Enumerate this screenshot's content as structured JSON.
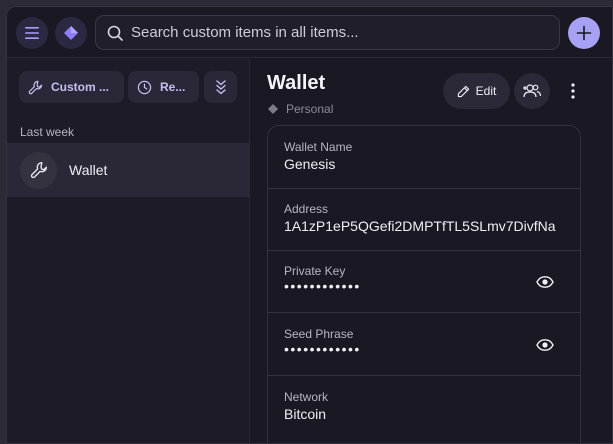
{
  "header": {
    "search_placeholder": "Search custom items in all items..."
  },
  "sidebar": {
    "filters": {
      "type_label": "Custom ...",
      "sort_label": "Re..."
    },
    "section_label": "Last week",
    "items": [
      {
        "title": "Wallet"
      }
    ]
  },
  "item": {
    "title": "Wallet",
    "vault": "Personal",
    "edit_label": "Edit",
    "fields": [
      {
        "label": "Wallet Name",
        "value": "Genesis"
      },
      {
        "label": "Address",
        "value": "1A1zP1eP5QGefi2DMPTfTL5SLmv7DivfNa"
      },
      {
        "label": "Private Key",
        "value": "••••••••••••"
      },
      {
        "label": "Seed Phrase",
        "value": "••••••••••••"
      },
      {
        "label": "Network",
        "value": "Bitcoin"
      }
    ]
  },
  "colors": {
    "accent": "#a7a1f4",
    "background": "#191823",
    "surface": "#2a2838"
  }
}
